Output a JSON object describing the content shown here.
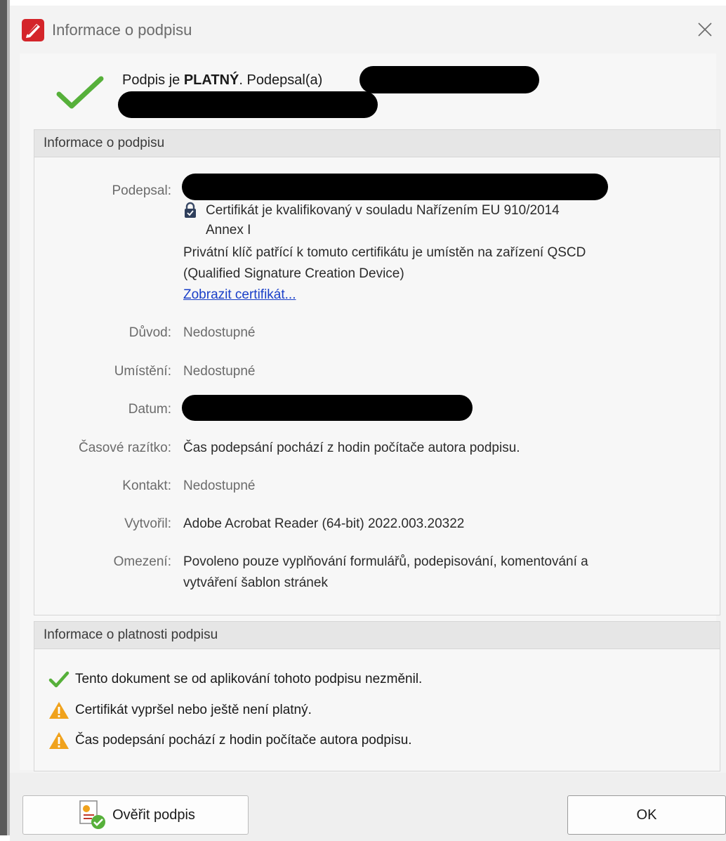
{
  "window": {
    "title": "Informace o podpisu",
    "close_icon": "close-icon"
  },
  "status": {
    "prefix": "Podpis je ",
    "state": "PLATNÝ",
    "suffix": ". Podepsal(a)",
    "icon": "checkmark-icon"
  },
  "signature_info": {
    "header": "Informace o podpisu",
    "rows": {
      "signed_by": {
        "label": "Podepsal:"
      },
      "cert_qualified": {
        "text1": "Certifikát je kvalifikovaný v souladu Nařízením EU 910/2014",
        "text2": "Annex I"
      },
      "private_key": {
        "text1": "Privátní klíč patřící k tomuto certifikátu je umístěn na zařízení QSCD",
        "text2": "(Qualified Signature Creation Device)"
      },
      "show_cert_link": "Zobrazit certifikát...",
      "reason": {
        "label": "Důvod:",
        "value": "Nedostupné"
      },
      "location": {
        "label": "Umístění:",
        "value": "Nedostupné"
      },
      "date": {
        "label": "Datum:"
      },
      "timestamp": {
        "label": "Časové razítko:",
        "value": "Čas podepsání pochází z hodin počítače autora podpisu."
      },
      "contact": {
        "label": "Kontakt:",
        "value": "Nedostupné"
      },
      "created_by": {
        "label": "Vytvořil:",
        "value": "Adobe Acrobat Reader (64-bit) 2022.003.20322"
      },
      "restrictions": {
        "label": "Omezení:",
        "value1": "Povoleno pouze vyplňování formulářů, podepisování, komentování a",
        "value2": "vytváření šablon stránek"
      }
    }
  },
  "validity_info": {
    "header": "Informace o platnosti podpisu",
    "items": [
      {
        "icon": "check-icon",
        "text": "Tento dokument se od aplikování tohoto podpisu nezměnil."
      },
      {
        "icon": "warning-icon",
        "text": "Certifikát vypršel nebo ještě není platný."
      },
      {
        "icon": "warning-icon",
        "text": "Čas podepsání pochází z hodin počítače autora podpisu."
      }
    ]
  },
  "buttons": {
    "verify_label": "Ověřit podpis",
    "ok_label": "OK"
  },
  "colors": {
    "check_green": "#56b03a",
    "warning_orange": "#f0a21c",
    "link_blue": "#1a3fc8",
    "app_red": "#d4252a"
  }
}
